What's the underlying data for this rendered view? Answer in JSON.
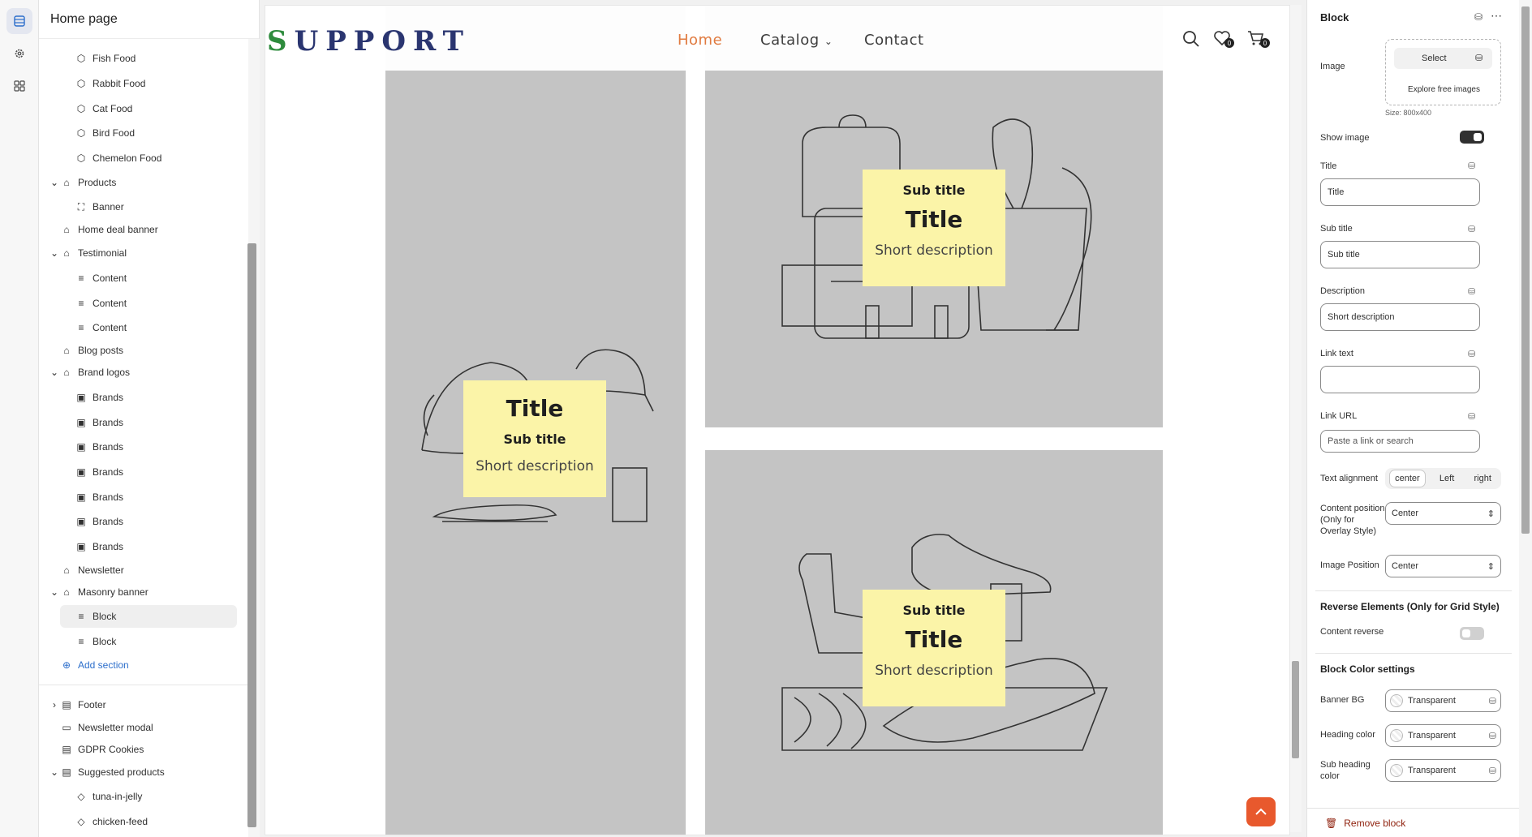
{
  "sidebar": {
    "title": "Home page",
    "items": [
      {
        "label": "Fish Food"
      },
      {
        "label": "Rabbit Food"
      },
      {
        "label": "Cat Food"
      },
      {
        "label": "Bird Food"
      },
      {
        "label": "Chemelon Food"
      },
      {
        "label": "Products"
      },
      {
        "label": "Banner"
      },
      {
        "label": "Home deal banner"
      },
      {
        "label": "Testimonial"
      },
      {
        "label": "Content"
      },
      {
        "label": "Content"
      },
      {
        "label": "Content"
      },
      {
        "label": "Blog posts"
      },
      {
        "label": "Brand logos"
      },
      {
        "label": "Brands"
      },
      {
        "label": "Brands"
      },
      {
        "label": "Brands"
      },
      {
        "label": "Brands"
      },
      {
        "label": "Brands"
      },
      {
        "label": "Brands"
      },
      {
        "label": "Brands"
      },
      {
        "label": "Newsletter"
      },
      {
        "label": "Masonry banner"
      },
      {
        "label": "Block"
      },
      {
        "label": "Block"
      },
      {
        "label": "Add section"
      },
      {
        "label": "Footer"
      },
      {
        "label": "Newsletter modal"
      },
      {
        "label": "GDPR Cookies"
      },
      {
        "label": "Suggested products"
      },
      {
        "label": "tuna-in-jelly"
      },
      {
        "label": "chicken-feed"
      }
    ]
  },
  "preview": {
    "logo_first": "S",
    "logo_rest": "UPPORT",
    "nav": {
      "home": "Home",
      "catalog": "Catalog",
      "contact": "Contact"
    },
    "wishlist_count": "0",
    "cart_count": "0",
    "blocks": [
      {
        "title": "Title",
        "subtitle": "Sub title",
        "description": "Short description"
      },
      {
        "title": "Title",
        "subtitle": "Sub title",
        "description": "Short description"
      },
      {
        "title": "Title",
        "subtitle": "Sub title",
        "description": "Short description"
      }
    ],
    "accent_color": "#e07a3f",
    "card_color": "#fbf4a8"
  },
  "panel": {
    "title": "Block",
    "image_label": "Image",
    "select_label": "Select",
    "explore_label": "Explore free images",
    "size_label": "Size: 800x400",
    "show_image_label": "Show image",
    "title_label": "Title",
    "title_value": "Title",
    "subtitle_label": "Sub title",
    "subtitle_value": "Sub title",
    "description_label": "Description",
    "description_value": "Short description",
    "link_text_label": "Link text",
    "link_text_value": "",
    "link_url_label": "Link URL",
    "link_url_placeholder": "Paste a link or search",
    "text_alignment_label": "Text alignment",
    "align_options": [
      "center",
      "Left",
      "right"
    ],
    "content_position_label": "Content position (Only for Overlay Style)",
    "content_position_value": "Center",
    "image_position_label": "Image Position",
    "image_position_value": "Center",
    "reverse_heading": "Reverse Elements (Only for Grid Style)",
    "content_reverse_label": "Content reverse",
    "color_heading": "Block Color settings",
    "banner_bg_label": "Banner BG",
    "banner_bg_value": "Transparent",
    "heading_color_label": "Heading color",
    "heading_color_value": "Transparent",
    "subheading_color_label": "Sub heading color",
    "subheading_color_value": "Transparent",
    "remove_label": "Remove block"
  }
}
